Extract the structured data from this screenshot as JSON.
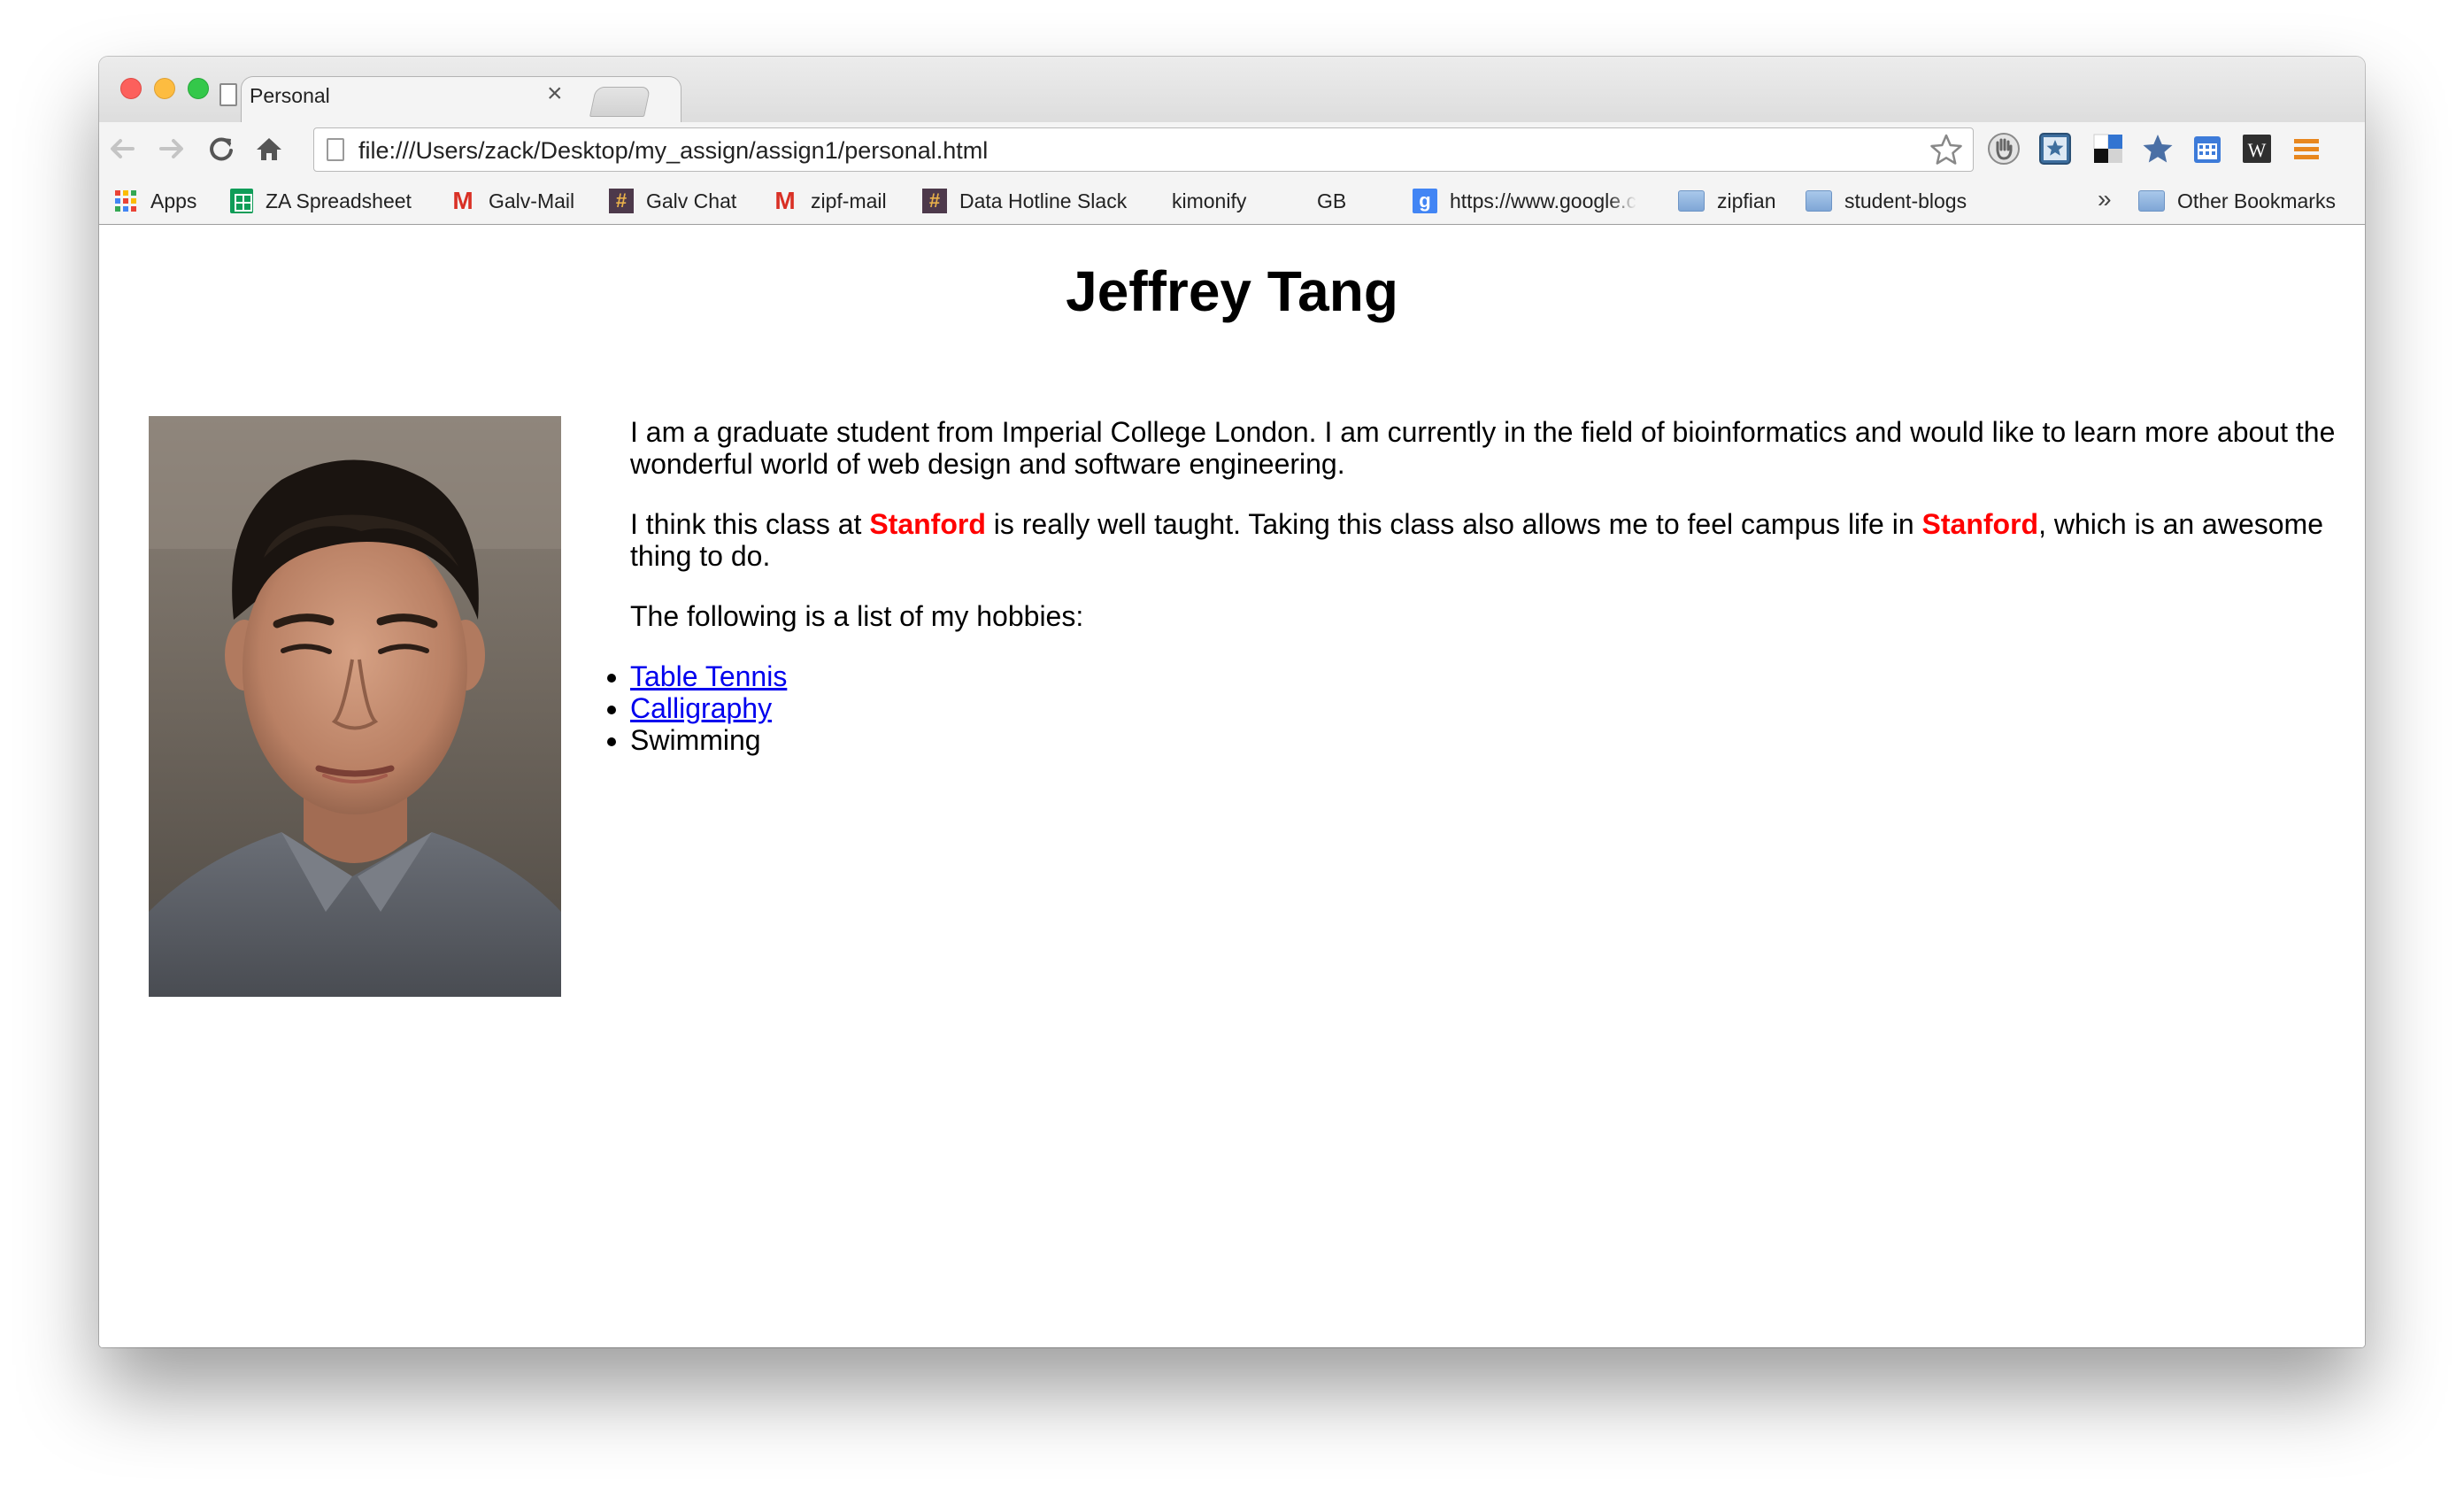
{
  "browser": {
    "tab_title": "Personal",
    "tab_close": "×",
    "url": "file:///Users/zack/Desktop/my_assign/assign1/personal.html"
  },
  "toolbar": {
    "back_icon": "back-arrow-icon",
    "forward_icon": "forward-arrow-icon",
    "reload_icon": "reload-icon",
    "home_icon": "home-icon",
    "bookmark_star_icon": "star-outline-icon",
    "extensions": [
      "hand-icon",
      "star-badge-icon",
      "delicious-icon",
      "star-icon",
      "calendar-icon",
      "wikipedia-icon",
      "menu-icon"
    ]
  },
  "bookmarks": {
    "items": [
      {
        "label": "Apps",
        "icon": "apps-grid-icon"
      },
      {
        "label": "ZA Spreadsheet",
        "icon": "sheets-icon"
      },
      {
        "label": "Galv-Mail",
        "icon": "gmail-icon"
      },
      {
        "label": "Galv Chat",
        "icon": "slack-icon"
      },
      {
        "label": "zipf-mail",
        "icon": "gmail-icon"
      },
      {
        "label": "Data Hotline Slack",
        "icon": "slack-icon"
      },
      {
        "label": "kimonify",
        "icon": "page-icon"
      },
      {
        "label": "GB",
        "icon": "page-icon"
      },
      {
        "label": "https://www.google.c",
        "icon": "google-icon"
      },
      {
        "label": "zipfian",
        "icon": "folder-icon"
      },
      {
        "label": "student-blogs",
        "icon": "folder-icon"
      }
    ],
    "overflow": "»",
    "other": "Other Bookmarks"
  },
  "page": {
    "title": "Jeffrey Tang",
    "photo_icon": "portrait-photo",
    "intro": "I am a graduate student from Imperial College London. I am currently in the field of bioinformatics and would like to learn more about the wonderful world of web design and software engineering.",
    "para2": {
      "before": "I think this class at ",
      "highlight1": "Stanford",
      "middle": " is really well taught. Taking this class also allows me to feel campus life in ",
      "highlight2": "Stanford",
      "after": ", which is an awesome thing to do."
    },
    "hobbies_intro": "The following is a list of my hobbies:",
    "hobbies": [
      {
        "label": "Table Tennis",
        "link": true
      },
      {
        "label": "Calligraphy",
        "link": true
      },
      {
        "label": "Swimming",
        "link": false
      }
    ]
  },
  "colors": {
    "highlight": "#ff0000",
    "link": "#0000ee"
  }
}
